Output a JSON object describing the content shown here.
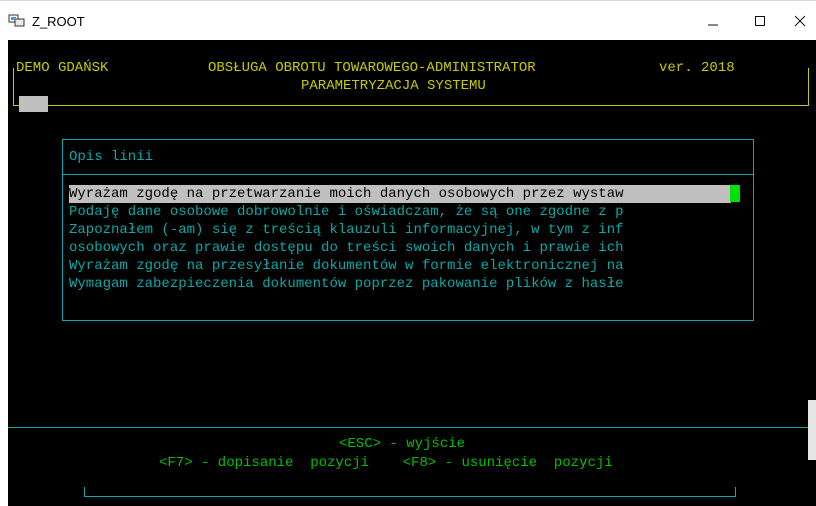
{
  "window": {
    "title": "Z_ROOT",
    "icon": "terminal-app-icon",
    "controls": [
      "minimize-icon",
      "maximize-icon",
      "close-icon"
    ]
  },
  "header": {
    "left": "DEMO GDAŃSK",
    "center": "OBSŁUGA OBROTU TOWAROWEGO-ADMINISTRATOR",
    "right": "ver. 2018",
    "subtitle": "PARAMETRYZACJA SYSTEMU"
  },
  "dialog": {
    "label": "Opis linii",
    "lines": [
      "Wyrażam zgodę na przetwarzanie moich danych osobowych przez wystaw",
      "Podaję dane osobowe dobrowolnie i oświadczam, że są one zgodne z p",
      "Zapoznałem (-am) się z treścią klauzuli informacyjnej, w tym z inf",
      "osobowych oraz prawie dostępu do treści swoich danych i prawie ich",
      "Wyrażam zgodę na przesyłanie dokumentów w formie elektronicznej na",
      "Wymagam zabezpieczenia dokumentów poprzez pakowanie plików z hasłe"
    ],
    "selected_index": 0
  },
  "footer": {
    "esc": "<ESC> - wyjście",
    "keys": "<F7> - dopisanie  pozycji    <F8> - usunięcie  pozycji"
  },
  "colors": {
    "header": "#c9c900",
    "cyan": "#0aa8a8",
    "green": "#00c000",
    "selection_bg": "#c0c0c0",
    "cursor": "#00e000"
  }
}
